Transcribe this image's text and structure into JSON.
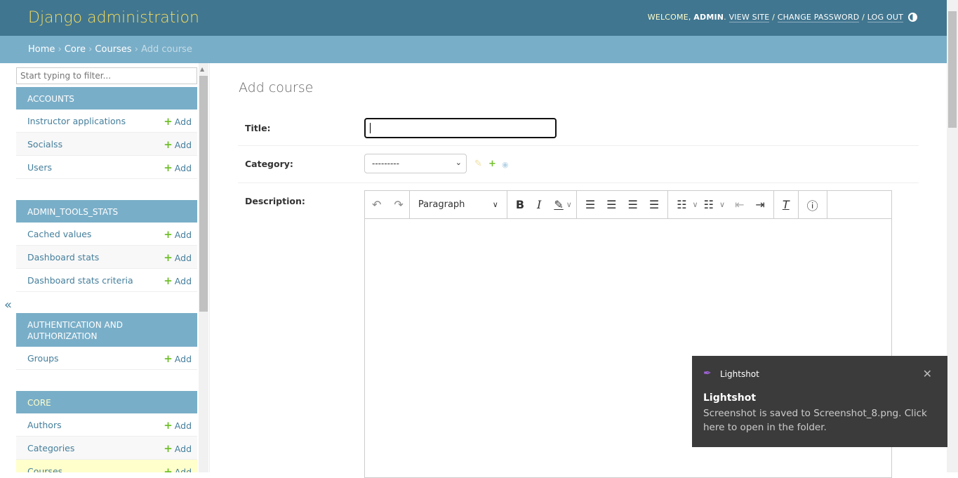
{
  "header": {
    "brand": "Django administration",
    "welcome": "WELCOME, ",
    "user": "ADMIN",
    "view_site": "VIEW SITE",
    "change_password": "CHANGE PASSWORD",
    "log_out": "LOG OUT"
  },
  "breadcrumbs": {
    "home": "Home",
    "app": "Core",
    "model": "Courses",
    "current": "Add course"
  },
  "sidebar": {
    "filter_placeholder": "Start typing to filter...",
    "add_label": "Add",
    "collapse": "«",
    "groups": [
      {
        "name": "ACCOUNTS",
        "items": [
          "Instructor applications",
          "Socialss",
          "Users"
        ]
      },
      {
        "name": "ADMIN_TOOLS_STATS",
        "items": [
          "Cached values",
          "Dashboard stats",
          "Dashboard stats criteria"
        ]
      },
      {
        "name": "AUTHENTICATION AND AUTHORIZATION",
        "items": [
          "Groups"
        ]
      },
      {
        "name": "CORE",
        "items": [
          "Authors",
          "Categories",
          "Courses"
        ]
      }
    ]
  },
  "main": {
    "title": "Add course",
    "fields": {
      "title_label": "Title:",
      "title_value": "",
      "category_label": "Category:",
      "category_value": "---------",
      "description_label": "Description:"
    },
    "editor": {
      "heading_select": "Paragraph"
    }
  },
  "toast": {
    "app": "Lightshot",
    "title": "Lightshot",
    "message": "Screenshot is saved to Screenshot_8.png. Click here to open in the folder."
  }
}
